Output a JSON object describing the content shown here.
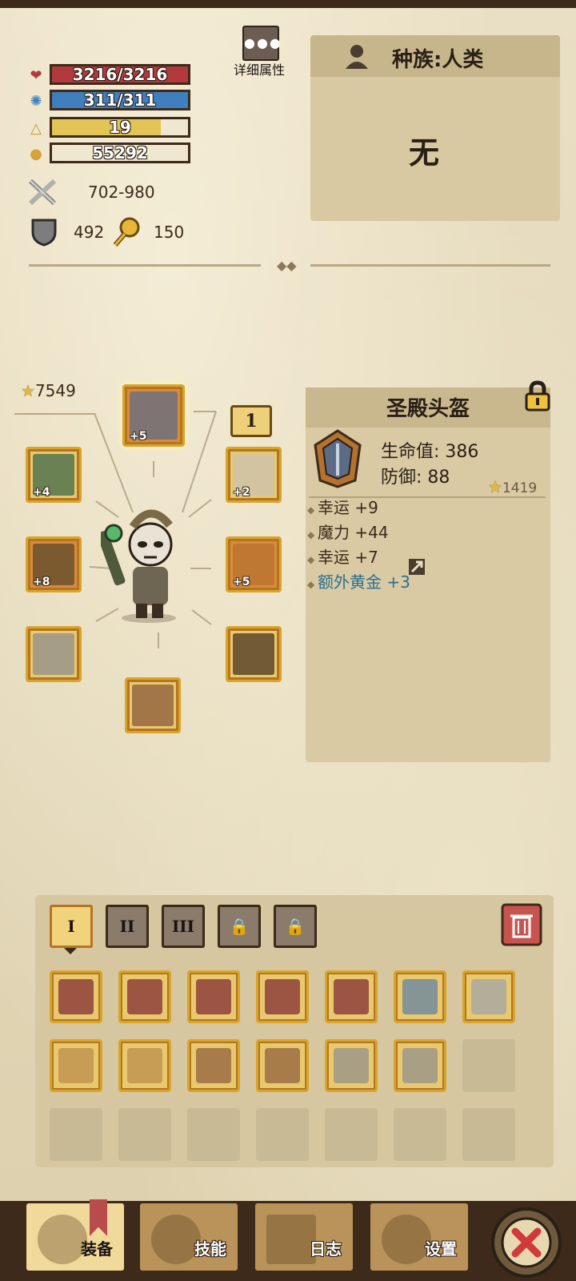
{
  "stats": {
    "hp": {
      "text": "3216/3216",
      "fill": 1.0,
      "color": "#b23a3f",
      "icon": "heart-icon"
    },
    "mp": {
      "text": "311/311",
      "fill": 1.0,
      "color": "#3f7fbd",
      "icon": "mana-icon"
    },
    "level": {
      "text": "19",
      "fill": 0.8,
      "color": "#e3c456",
      "icon": "triangle-icon"
    },
    "gold": {
      "text": "55292",
      "fill": 0.0,
      "color": "#efe7d0",
      "icon": "gold-icon"
    },
    "attack": "702-980",
    "defense": "492",
    "luck": "150"
  },
  "detail_button": {
    "label": "详细属性",
    "icon": "dots-icon"
  },
  "race": {
    "label": "种族:人类",
    "value": "无",
    "icon": "person-icon"
  },
  "equipment": {
    "score": "7549",
    "level_badge": "1",
    "slots": [
      {
        "name": "helmet",
        "plus": "+5",
        "frame": "orange"
      },
      {
        "name": "amulet-left",
        "plus": "+4",
        "frame": "gold"
      },
      {
        "name": "weapon",
        "plus": "+8",
        "frame": "orange"
      },
      {
        "name": "gloves",
        "plus": "",
        "frame": "gold"
      },
      {
        "name": "boots",
        "plus": "",
        "frame": "gold"
      },
      {
        "name": "necklace",
        "plus": "+2",
        "frame": "gold"
      },
      {
        "name": "armor",
        "plus": "+5",
        "frame": "orange"
      },
      {
        "name": "pants",
        "plus": "",
        "frame": "gold"
      }
    ]
  },
  "item_detail": {
    "title": "圣殿头盔",
    "hp_line": "生命值: 386",
    "def_line": "防御: 88",
    "score": "1419",
    "attributes": [
      {
        "text": "幸运 +9",
        "color": "#3a2a1a"
      },
      {
        "text": "魔力 +44",
        "color": "#3a2a1a"
      },
      {
        "text": "幸运 +7",
        "color": "#3a2a1a"
      },
      {
        "text": "额外黄金 +3",
        "color": "#2a6f8f"
      }
    ]
  },
  "inventory": {
    "tabs": [
      "I",
      "II",
      "III",
      "",
      ""
    ],
    "rows": [
      [
        "sword-red",
        "sword-red",
        "sword-red",
        "sword-red",
        "sword-red",
        "spear",
        "blade"
      ],
      [
        "straw-hat",
        "straw-hat",
        "gloves",
        "boots",
        "gauntlet",
        "gauntlet",
        ""
      ],
      [
        "",
        "",
        "",
        "",
        "",
        "",
        ""
      ]
    ]
  },
  "nav": {
    "equip": "装备",
    "skills": "技能",
    "log": "日志",
    "settings": "设置"
  }
}
